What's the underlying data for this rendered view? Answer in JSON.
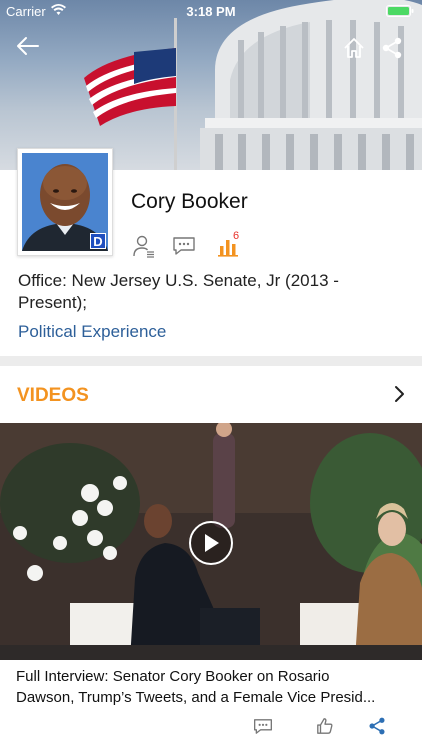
{
  "status_bar": {
    "carrier": "Carrier",
    "time": "3:18 PM",
    "battery_color": "#4cd964",
    "wifi_icon": "wifi-icon",
    "battery_icon": "battery-icon"
  },
  "nav": {
    "back_icon": "arrow-left-icon",
    "home_icon": "home-icon",
    "share_icon": "share-icon"
  },
  "profile": {
    "name": "Cory Booker",
    "party_badge": "D",
    "party_color": "#1f4fbf",
    "office_line1": "Office: New Jersey U.S. Senate, Jr (2013 -",
    "office_line2": "Present);",
    "political_experience_link": "Political Experience",
    "poll_count": "6",
    "icons": [
      "person-list-icon",
      "comment-icon",
      "bar-chart-icon"
    ]
  },
  "videos": {
    "section_title": "VIDEOS",
    "accent_color": "#f39320",
    "items": [
      {
        "title_line1": "Full Interview: Senator Cory Booker on Rosario",
        "title_line2": "Dawson, Trump’s Tweets, and a Female Vice Presid..."
      }
    ],
    "action_icons": [
      "comment-icon",
      "thumbs-up-icon",
      "share-icon"
    ]
  },
  "colors": {
    "link": "#2d5f99",
    "divider": "#ececec"
  }
}
